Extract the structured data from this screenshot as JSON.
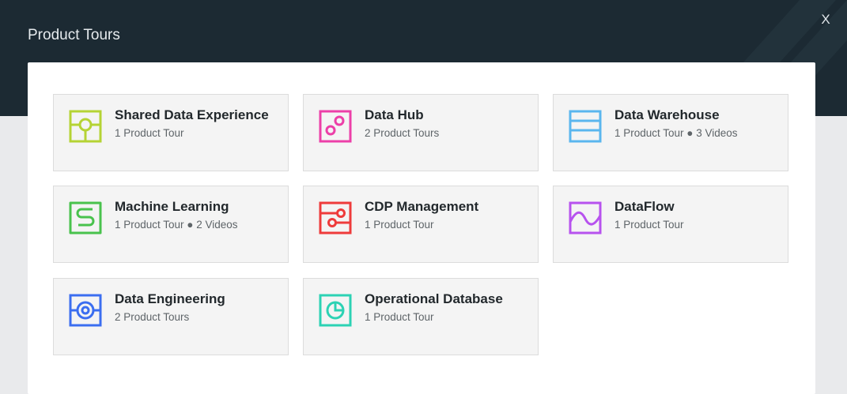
{
  "modal": {
    "title": "Product Tours",
    "close_label": "X"
  },
  "cards": [
    {
      "title": "Shared Data Experience",
      "subtitle": "1 Product Tour",
      "icon": "sdx-icon",
      "color": "#b5d334"
    },
    {
      "title": "Data Hub",
      "subtitle": "2 Product Tours",
      "icon": "data-hub-icon",
      "color": "#ec3fa8"
    },
    {
      "title": "Data Warehouse",
      "subtitle": "1 Product Tour ● 3 Videos",
      "icon": "data-warehouse-icon",
      "color": "#5ab6ee"
    },
    {
      "title": "Machine Learning",
      "subtitle": "1 Product Tour ● 2 Videos",
      "icon": "machine-learning-icon",
      "color": "#49c24d"
    },
    {
      "title": "CDP Management",
      "subtitle": "1 Product Tour",
      "icon": "cdp-management-icon",
      "color": "#ee3b3b"
    },
    {
      "title": "DataFlow",
      "subtitle": "1 Product Tour",
      "icon": "dataflow-icon",
      "color": "#b752ee"
    },
    {
      "title": "Data Engineering",
      "subtitle": "2 Product Tours",
      "icon": "data-engineering-icon",
      "color": "#3b6ef0"
    },
    {
      "title": "Operational Database",
      "subtitle": "1 Product Tour",
      "icon": "operational-database-icon",
      "color": "#2cd2b4"
    }
  ]
}
